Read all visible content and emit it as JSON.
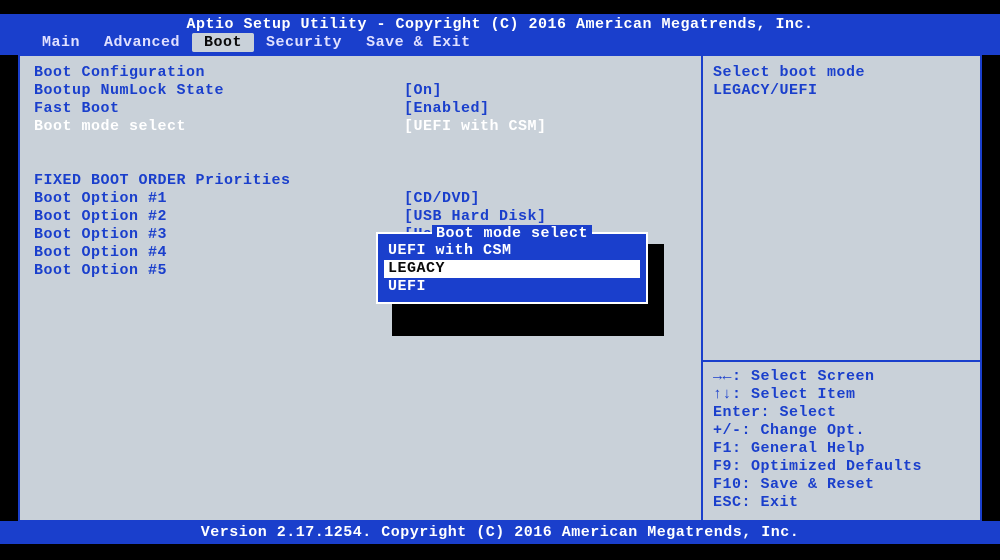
{
  "title": "Aptio Setup Utility - Copyright (C) 2016 American Megatrends, Inc.",
  "footer": "Version 2.17.1254. Copyright (C) 2016 American Megatrends, Inc.",
  "tabs": {
    "main": "Main",
    "advanced": "Advanced",
    "boot": "Boot",
    "security": "Security",
    "saveexit": "Save & Exit"
  },
  "section1_header": "Boot Configuration",
  "settings": {
    "numlock": {
      "label": "Bootup NumLock State",
      "value": "[On]"
    },
    "fastboot": {
      "label": "Fast Boot",
      "value": "[Enabled]"
    },
    "bootmode": {
      "label": "Boot mode select",
      "value": "[UEFI with CSM]"
    }
  },
  "section2_header": "FIXED BOOT ORDER Priorities",
  "bootopts": {
    "o1": {
      "label": "Boot Option #1",
      "value": "[CD/DVD]"
    },
    "o2": {
      "label": "Boot Option #2",
      "value": "[USB Hard Disk]"
    },
    "o3": {
      "label": "Boot Option #3",
      "value": "[Hard Disk]"
    },
    "o4": {
      "label": "Boot Option #4",
      "value": ""
    },
    "o5": {
      "label": "Boot Option #5",
      "value": ""
    }
  },
  "popup": {
    "title": " Boot mode select ",
    "opt1": "UEFI with CSM",
    "opt2": "LEGACY",
    "opt3": "UEFI"
  },
  "sidehelp": {
    "line1": "Select boot mode",
    "line2": "LEGACY/UEFI"
  },
  "keys": {
    "k1": "→←: Select Screen",
    "k2": "↑↓: Select Item",
    "k3": "Enter: Select",
    "k4": "+/-: Change Opt.",
    "k5": "F1: General Help",
    "k6": "F9: Optimized Defaults",
    "k7": "F10: Save & Reset",
    "k8": "ESC: Exit"
  }
}
